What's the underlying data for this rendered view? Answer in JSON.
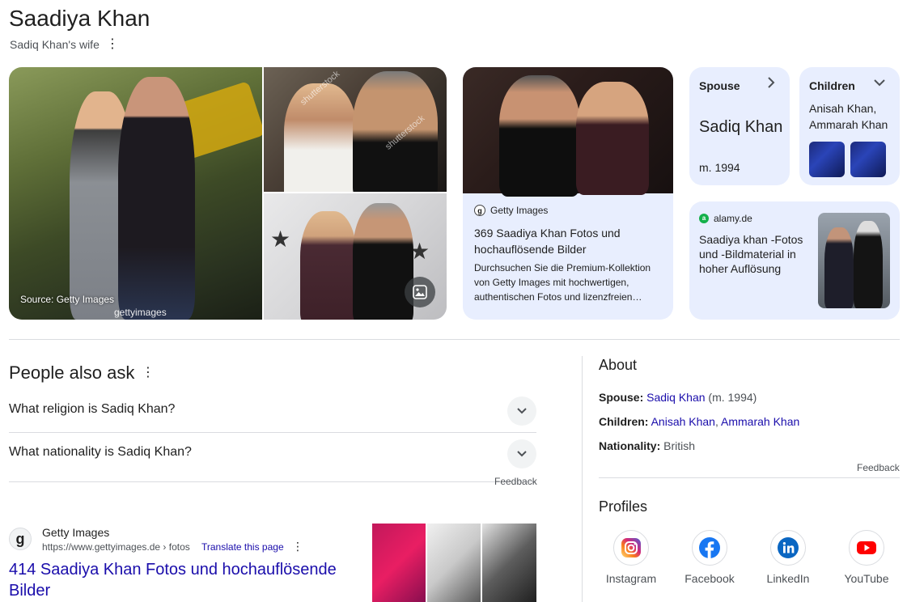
{
  "header": {
    "title": "Saadiya Khan",
    "subtitle": "Sadiq Khan's wife"
  },
  "images": {
    "source_label": "Source: Getty Images",
    "watermark_getty": "gettyimages",
    "watermark_shutterstock": "shutterstock"
  },
  "getty_card": {
    "site": "Getty Images",
    "title": "369 Saadiya Khan Fotos und hochauflösende Bilder",
    "description": "Durchsuchen Sie die Premium-Kollektion von Getty Images mit hochwertigen, authentischen Fotos und lizenzfreien…"
  },
  "spouse_card": {
    "heading": "Spouse",
    "name": "Sadiq Khan",
    "married": "m. 1994"
  },
  "children_card": {
    "heading": "Children",
    "names": "Anisah Khan, Ammarah Khan"
  },
  "alamy_card": {
    "site": "alamy.de",
    "title": "Saadiya khan -Fotos und -Bildmaterial in hoher Auflösung"
  },
  "people_also_ask": {
    "title": "People also ask",
    "questions": [
      "What religion is Sadiq Khan?",
      "What nationality is Sadiq Khan?"
    ],
    "feedback": "Feedback"
  },
  "result": {
    "site": "Getty Images",
    "url": "https://www.gettyimages.de › fotos",
    "translate": "Translate this page",
    "title": "414 Saadiya Khan Fotos und hochauflösende Bilder"
  },
  "about": {
    "title": "About",
    "spouse_label": "Spouse:",
    "spouse_value": "Sadiq Khan",
    "spouse_suffix": "(m. 1994)",
    "children_label": "Children:",
    "child_1": "Anisah Khan",
    "child_2": "Ammarah Khan",
    "nationality_label": "Nationality:",
    "nationality_value": "British",
    "feedback": "Feedback"
  },
  "profiles": {
    "title": "Profiles",
    "items": [
      {
        "label": "Instagram",
        "icon": "instagram-icon",
        "color": "#c13584"
      },
      {
        "label": "Facebook",
        "icon": "facebook-icon",
        "color": "#1877f2"
      },
      {
        "label": "LinkedIn",
        "icon": "linkedin-icon",
        "color": "#0a66c2"
      },
      {
        "label": "YouTube",
        "icon": "youtube-icon",
        "color": "#ff0000"
      }
    ]
  },
  "colors": {
    "link": "#1a0dab",
    "card_bg": "#e8eefe",
    "text": "#1f1f1f",
    "muted": "#4d5156"
  }
}
